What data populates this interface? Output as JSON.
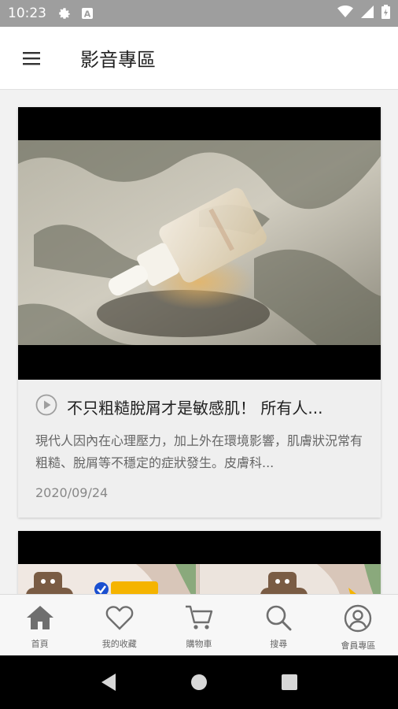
{
  "status_bar": {
    "time": "10:23",
    "left_icons": [
      "gear-icon",
      "a-notification-icon"
    ],
    "right_icons": [
      "wifi-icon",
      "signal-icon",
      "battery-icon"
    ]
  },
  "header": {
    "menu_icon": "hamburger-menu-icon",
    "title": "影音專區"
  },
  "videos": [
    {
      "title": "不只粗糙脫屑才是敏感肌！ 所有人...",
      "description": "現代人因內在心理壓力，加上外在環境影響，肌膚狀況常有粗糙、脫屑等不穩定的症狀發生。皮膚科...",
      "date": "2020/09/24",
      "play_icon": "play-circle-icon"
    },
    {
      "title": "",
      "description": "",
      "date": ""
    }
  ],
  "bottom_nav": {
    "items": [
      {
        "label": "首頁",
        "icon": "home-icon"
      },
      {
        "label": "我的收藏",
        "icon": "heart-icon"
      },
      {
        "label": "購物車",
        "icon": "cart-icon"
      },
      {
        "label": "搜尋",
        "icon": "search-icon"
      },
      {
        "label": "會員專區",
        "icon": "user-icon"
      }
    ]
  },
  "system_nav": {
    "icons": [
      "back-icon",
      "home-circle-icon",
      "recents-icon"
    ]
  },
  "colors": {
    "status_bar": "#9e9e9e",
    "nav_icon": "#6f6f6f",
    "card_bg": "#efefef",
    "content_bg": "#f2f2f2"
  }
}
